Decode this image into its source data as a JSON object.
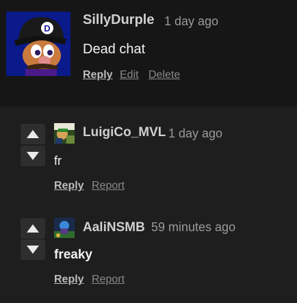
{
  "comments": [
    {
      "username": "SillyDurple",
      "timestamp": "1 day ago",
      "text": "Dead chat",
      "actions": [
        "Reply",
        "Edit",
        "Delete"
      ]
    },
    {
      "username": "LuigiCo_MVL",
      "timestamp": "1 day ago",
      "text": "fr",
      "actions": [
        "Reply",
        "Report"
      ]
    },
    {
      "username": "AaliNSMB",
      "timestamp": "59 minutes ago",
      "text": "freaky",
      "actions": [
        "Reply",
        "Report"
      ]
    }
  ],
  "icons": {
    "upvote": "upvote-arrow-icon",
    "downvote": "downvote-arrow-icon"
  },
  "colors": {
    "background": "#1b1b1b",
    "top_comment_background": "#161616",
    "vote_button": "#2e2e2e",
    "username": "#cfcfcf",
    "timestamp": "#9a9a9a"
  }
}
